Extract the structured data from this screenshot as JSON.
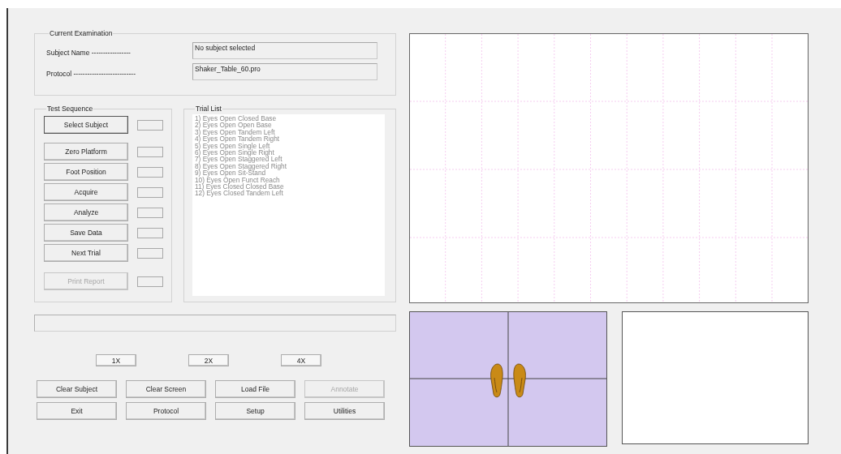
{
  "exam": {
    "title": "Current Examination",
    "fields": [
      {
        "label": "Subject Name -----------------",
        "value": "No subject selected"
      },
      {
        "label": "Protocol ---------------------------",
        "value": "Shaker_Table_60.pro"
      }
    ]
  },
  "test_sequence": {
    "title": "Test Sequence",
    "steps": [
      {
        "label": "Select Subject",
        "disabled": false
      },
      {
        "label": "Zero Platform",
        "disabled": false
      },
      {
        "label": "Foot Position",
        "disabled": false
      },
      {
        "label": "Acquire",
        "disabled": false
      },
      {
        "label": "Analyze",
        "disabled": false
      },
      {
        "label": "Save Data",
        "disabled": false
      },
      {
        "label": "Next Trial",
        "disabled": false
      },
      {
        "label": "Print Report",
        "disabled": true
      }
    ]
  },
  "trial_list": {
    "title": "Trial List",
    "items": [
      "1) Eyes Open Closed Base",
      "2) Eyes Open Open Base",
      "3) Eyes Open Tandem Left",
      "4) Eyes Open Tandem Right",
      "5) Eyes Open Single Left",
      "6) Eyes Open Single Right",
      "7) Eyes Open Staggered Left",
      "8) Eyes Open Staggered Right",
      "9) Eyes Open Sit-Stand",
      "10) Eyes Open Funct Reach",
      "11) Eyes Closed Closed Base",
      "12) Eyes Closed Tandem Left"
    ]
  },
  "zoom_buttons": [
    "1X",
    "2X",
    "4X"
  ],
  "buttons": [
    {
      "label": "Clear Subject",
      "disabled": false
    },
    {
      "label": "Clear Screen",
      "disabled": false
    },
    {
      "label": "Load File",
      "disabled": false
    },
    {
      "label": "Annotate",
      "disabled": true
    },
    {
      "label": "Exit",
      "disabled": false
    },
    {
      "label": "Protocol",
      "disabled": false
    },
    {
      "label": "Setup",
      "disabled": false
    },
    {
      "label": "Utilities",
      "disabled": false
    }
  ]
}
